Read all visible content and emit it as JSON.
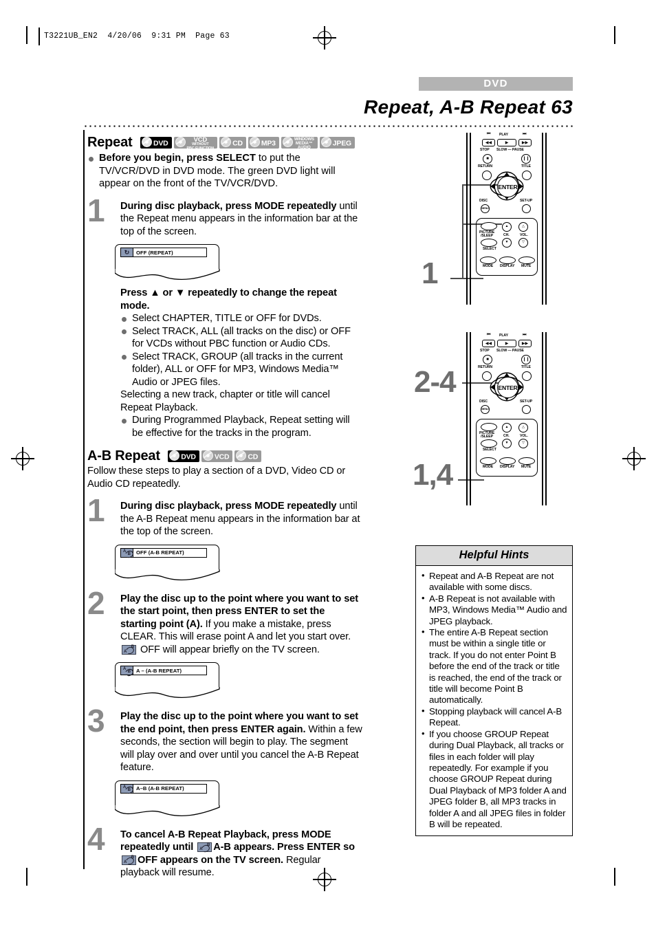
{
  "print_slug": "T3221UB_EN2  4/20/06  9:31 PM  Page 63",
  "header": {
    "tab_label": "DVD",
    "title": "Repeat, A-B Repeat  63"
  },
  "repeat_section": {
    "heading": "Repeat",
    "badges": [
      {
        "name": "dvd-badge",
        "label": "DVD",
        "style": "dark"
      },
      {
        "name": "vcd-badge",
        "l1": "VCD",
        "l2": "WITHOUT",
        "l3": "PBC FUNCTION",
        "style": "grey"
      },
      {
        "name": "cd-badge",
        "label": "CD",
        "style": "grey"
      },
      {
        "name": "mp3-badge",
        "label": "MP3",
        "style": "grey"
      },
      {
        "name": "windows-media-audio-badge",
        "l1": "WINDOWS",
        "l2": "MEDIA™",
        "l3": "AUDIO",
        "style": "grey"
      },
      {
        "name": "jpeg-badge",
        "label": "JPEG",
        "style": "grey"
      }
    ],
    "intro_bold": "Before you begin, press SELECT",
    "intro_rest": " to put the TV/VCR/DVD in DVD mode. The green DVD light will appear on the front of the TV/VCR/DVD.",
    "step1": {
      "number": "1",
      "bold": "During disc playback, press MODE repeatedly",
      "rest": " until the Repeat menu appears in the information bar at the top of the screen.",
      "screen_text": "OFF (REPEAT)",
      "screen_icon": "repeat-icon"
    },
    "press_updown": "Press ▲ or ▼ repeatedly to change the repeat mode.",
    "bullets": [
      "Select CHAPTER, TITLE or OFF for DVDs.",
      "Select TRACK, ALL (all tracks on the disc) or OFF for VCDs without PBC function or Audio CDs.",
      "Select TRACK, GROUP (all tracks in the current folder), ALL or OFF for MP3, Windows Media™ Audio or JPEG files."
    ],
    "note": "Selecting a new track, chapter or title will cancel Repeat Playback.",
    "last_bullet": "During Programmed Playback, Repeat setting will be effective for the tracks in the program."
  },
  "ab_section": {
    "heading": "A-B Repeat",
    "badges": [
      {
        "name": "dvd-badge",
        "label": "DVD",
        "style": "dark"
      },
      {
        "name": "vcd-badge",
        "label": "VCD",
        "style": "grey"
      },
      {
        "name": "cd-badge",
        "label": "CD",
        "style": "grey"
      }
    ],
    "intro": "Follow these steps to play a section of a DVD, Video CD or Audio CD repeatedly.",
    "steps": [
      {
        "number": "1",
        "bold": "During disc playback, press MODE repeatedly",
        "rest": " until the A-B Repeat menu appears in the information bar at the top of the screen.",
        "screen_text": "OFF (A-B REPEAT)",
        "screen_icon": "ab-repeat-icon"
      },
      {
        "number": "2",
        "bold": "Play the disc up to the point where you want to set the start point, then press ENTER to set the starting point (A).",
        "rest": " If you make a mistake, press CLEAR. This will erase point A and let you start over.",
        "rest2": " OFF will appear briefly on the TV screen.",
        "screen_text": "A –  (A-B REPEAT)",
        "screen_icon": "ab-repeat-icon"
      },
      {
        "number": "3",
        "bold": "Play the disc up to the point where you want to set the end point, then press ENTER again.",
        "rest": " Within a few seconds, the section will begin to play. The segment will play over and over until you cancel the A-B Repeat feature.",
        "screen_text": "A–B (A-B REPEAT)",
        "screen_icon": "ab-repeat-icon"
      },
      {
        "number": "4",
        "bold_a": "To cancel A-B Repeat Playback, press MODE repeatedly until",
        "bold_b": "A-B appears. Press ENTER so",
        "bold_c": "OFF appears on the TV screen.",
        "rest": " Regular playback will resume."
      }
    ]
  },
  "remotes": [
    {
      "name": "remote-diagram-top",
      "step_label": "1",
      "buttons": {
        "rew": "◀◀",
        "play": "▶",
        "ff": "▶▶",
        "prev": "❘◀◀",
        "next": "▶▶❘",
        "stop_label": "STOP",
        "slow_label": "SLOW — PAUSE",
        "play_label": "PLAY",
        "return_label": "RETURN",
        "title_label": "TITLE",
        "disc_label": "DISC",
        "disc_glyph": "MENU",
        "setup_label": "SET-UP",
        "enter_label": "ENTER",
        "picture_label": "PICTURE /SLEEP",
        "select_label": "SELECT",
        "ch_label": "CH.",
        "vol_label": "VOL.",
        "mode_label": "MODE",
        "display_label": "DISPLAY",
        "mute_label": "MUTE"
      }
    },
    {
      "name": "remote-diagram-bottom",
      "step_label_top": "2-4",
      "step_label_bottom": "1,4"
    }
  ],
  "hints": {
    "title": "Helpful Hints",
    "items": [
      "Repeat and A-B Repeat are not available with some discs.",
      "A-B Repeat is not available with MP3, Windows Media™ Audio and JPEG playback.",
      "The entire A-B Repeat section must be within a single title or track. If you do not enter Point B before the end of the track or title is reached, the end of the track or title will become Point B automatically.",
      "Stopping playback will cancel A-B Repeat.",
      "If you choose GROUP Repeat during Dual Playback, all tracks or files in each folder will play repeatedly. For example if you choose GROUP Repeat during Dual Playback of MP3 folder A and JPEG folder B, all MP3 tracks in folder A and all JPEG files in folder B will be repeated."
    ]
  },
  "colors": {
    "tab_bg": "#b3b3b3",
    "step_number": "#8a8a8a",
    "hint_title_bg": "#dcdcdc",
    "infobar_icon": "#8d9bb5"
  }
}
